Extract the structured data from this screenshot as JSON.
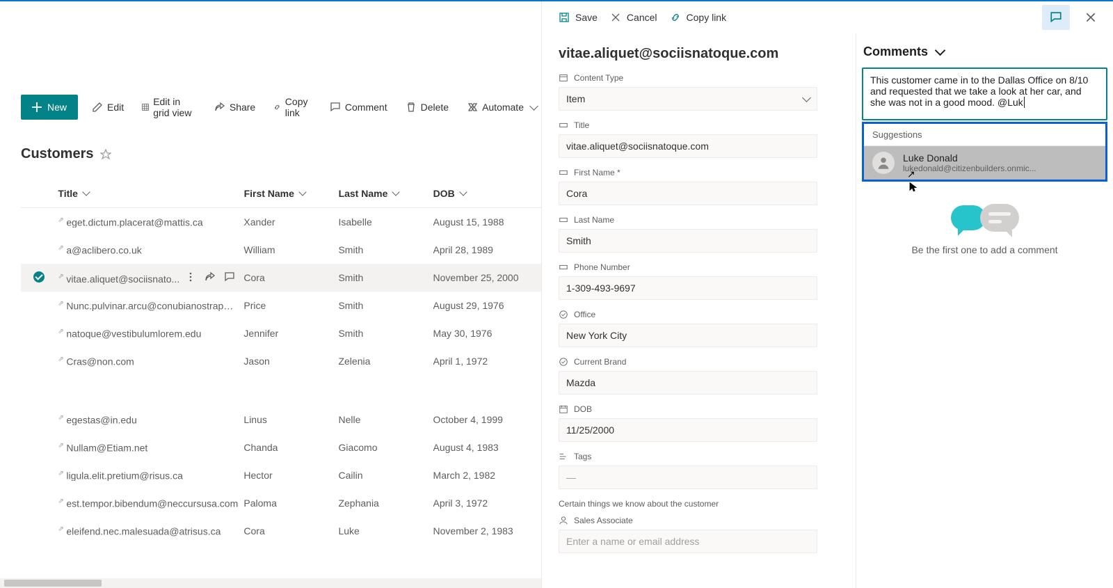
{
  "toolbar": {
    "new": "New",
    "edit": "Edit",
    "grid_edit": "Edit in grid view",
    "share": "Share",
    "copy_link": "Copy link",
    "comment": "Comment",
    "delete": "Delete",
    "automate": "Automate"
  },
  "list": {
    "title": "Customers",
    "columns": {
      "title": "Title",
      "first_name": "First Name",
      "last_name": "Last Name",
      "dob": "DOB"
    },
    "rows": [
      {
        "title": "eget.dictum.placerat@mattis.ca",
        "first_name": "Xander",
        "last_name": "Isabelle",
        "dob": "August 15, 1988"
      },
      {
        "title": "a@aclibero.co.uk",
        "first_name": "William",
        "last_name": "Smith",
        "dob": "April 28, 1989"
      },
      {
        "title": "vitae.aliquet@sociisnato...",
        "first_name": "Cora",
        "last_name": "Smith",
        "dob": "November 25, 2000",
        "selected": true
      },
      {
        "title": "Nunc.pulvinar.arcu@conubianostraper.edu",
        "first_name": "Price",
        "last_name": "Smith",
        "dob": "August 29, 1976"
      },
      {
        "title": "natoque@vestibulumlorem.edu",
        "first_name": "Jennifer",
        "last_name": "Smith",
        "dob": "May 30, 1976"
      },
      {
        "title": "Cras@non.com",
        "first_name": "Jason",
        "last_name": "Zelenia",
        "dob": "April 1, 1972"
      },
      {
        "gap": true
      },
      {
        "title": "egestas@in.edu",
        "first_name": "Linus",
        "last_name": "Nelle",
        "dob": "October 4, 1999"
      },
      {
        "title": "Nullam@Etiam.net",
        "first_name": "Chanda",
        "last_name": "Giacomo",
        "dob": "August 4, 1983"
      },
      {
        "title": "ligula.elit.pretium@risus.ca",
        "first_name": "Hector",
        "last_name": "Cailin",
        "dob": "March 2, 1982"
      },
      {
        "title": "est.tempor.bibendum@neccursusa.com",
        "first_name": "Paloma",
        "last_name": "Zephania",
        "dob": "April 3, 1972"
      },
      {
        "title": "eleifend.nec.malesuada@atrisus.ca",
        "first_name": "Cora",
        "last_name": "Luke",
        "dob": "November 2, 1983"
      }
    ]
  },
  "panel": {
    "save": "Save",
    "cancel": "Cancel",
    "copy_link": "Copy link",
    "title": "vitae.aliquet@sociisnatoque.com",
    "fields": {
      "content_type": {
        "label": "Content Type",
        "value": "Item"
      },
      "title": {
        "label": "Title",
        "value": "vitae.aliquet@sociisnatoque.com"
      },
      "first_name": {
        "label": "First Name *",
        "value": "Cora"
      },
      "last_name": {
        "label": "Last Name",
        "value": "Smith"
      },
      "phone": {
        "label": "Phone Number",
        "value": "1-309-493-9697"
      },
      "office": {
        "label": "Office",
        "value": "New York City"
      },
      "brand": {
        "label": "Current Brand",
        "value": "Mazda"
      },
      "dob": {
        "label": "DOB",
        "value": "11/25/2000"
      },
      "tags": {
        "label": "Tags",
        "value": "—"
      },
      "section_note": "Certain things we know about the customer",
      "sales_assoc": {
        "label": "Sales Associate",
        "placeholder": "Enter a name or email address"
      }
    }
  },
  "comments": {
    "heading": "Comments",
    "draft": "This customer came in to the Dallas Office on 8/10 and requested that we take a look at her car, and she was not in a good mood. @Luk",
    "suggestions_label": "Suggestions",
    "suggestion": {
      "name": "Luke Donald",
      "email": "lukedonald@citizenbuilders.onmic..."
    },
    "empty": "Be the first one to add a comment"
  }
}
